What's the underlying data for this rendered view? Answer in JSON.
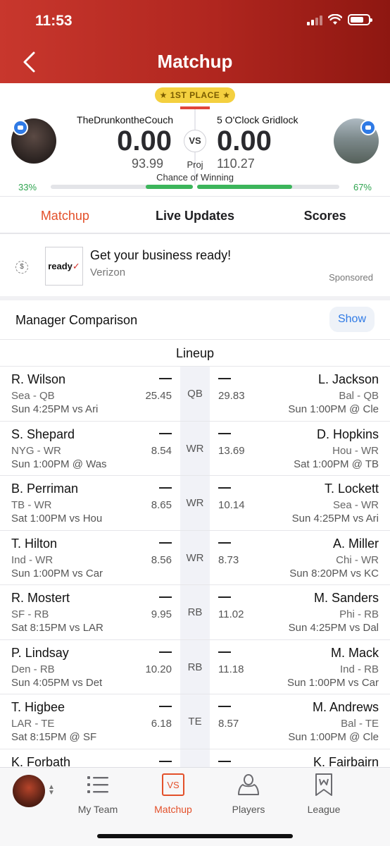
{
  "status_bar": {
    "time": "11:53"
  },
  "header": {
    "title": "Matchup"
  },
  "scoreboard": {
    "badge": "★ 1ST PLACE ★",
    "vs": "VS",
    "proj_label": "Proj",
    "chance_label": "Chance of Winning",
    "left": {
      "team": "TheDrunkontheCouch",
      "score": "0.00",
      "proj": "93.99",
      "pct": "33%",
      "win_fraction": 0.33
    },
    "right": {
      "team": "5 O'Clock Gridlock",
      "score": "0.00",
      "proj": "110.27",
      "pct": "67%",
      "win_fraction": 0.67
    }
  },
  "tabs": [
    {
      "label": "Matchup"
    },
    {
      "label": "Live Updates"
    },
    {
      "label": "Scores"
    }
  ],
  "ad": {
    "logo_text": "ready",
    "logo_mark": "✓",
    "title": "Get your business ready!",
    "advertiser": "Verizon",
    "sponsored": "Sponsored"
  },
  "manager": {
    "title": "Manager Comparison",
    "show_label": "Show"
  },
  "lineup": {
    "title": "Lineup",
    "rows": [
      {
        "pos": "QB",
        "left": {
          "name": "R. Wilson",
          "team": "Sea - QB",
          "game": "Sun 4:25PM vs Ari",
          "score": "—",
          "proj": "25.45"
        },
        "right": {
          "name": "L. Jackson",
          "team": "Bal - QB",
          "game": "Sun 1:00PM @ Cle",
          "score": "—",
          "proj": "29.83"
        }
      },
      {
        "pos": "WR",
        "left": {
          "name": "S. Shepard",
          "team": "NYG - WR",
          "game": "Sun 1:00PM @ Was",
          "score": "—",
          "proj": "8.54"
        },
        "right": {
          "name": "D. Hopkins",
          "team": "Hou - WR",
          "game": "Sat 1:00PM @ TB",
          "score": "—",
          "proj": "13.69"
        }
      },
      {
        "pos": "WR",
        "left": {
          "name": "B. Perriman",
          "team": "TB - WR",
          "game": "Sat 1:00PM vs Hou",
          "score": "—",
          "proj": "8.65"
        },
        "right": {
          "name": "T. Lockett",
          "team": "Sea - WR",
          "game": "Sun 4:25PM vs Ari",
          "score": "—",
          "proj": "10.14"
        }
      },
      {
        "pos": "WR",
        "left": {
          "name": "T. Hilton",
          "team": "Ind - WR",
          "game": "Sun 1:00PM vs Car",
          "score": "—",
          "proj": "8.56"
        },
        "right": {
          "name": "A. Miller",
          "team": "Chi - WR",
          "game": "Sun 8:20PM vs KC",
          "score": "—",
          "proj": "8.73"
        }
      },
      {
        "pos": "RB",
        "left": {
          "name": "R. Mostert",
          "team": "SF - RB",
          "game": "Sat 8:15PM vs LAR",
          "score": "—",
          "proj": "9.95"
        },
        "right": {
          "name": "M. Sanders",
          "team": "Phi - RB",
          "game": "Sun 4:25PM vs Dal",
          "score": "—",
          "proj": "11.02"
        }
      },
      {
        "pos": "RB",
        "left": {
          "name": "P. Lindsay",
          "team": "Den - RB",
          "game": "Sun 4:05PM vs Det",
          "score": "—",
          "proj": "10.20"
        },
        "right": {
          "name": "M. Mack",
          "team": "Ind - RB",
          "game": "Sun 1:00PM vs Car",
          "score": "—",
          "proj": "11.18"
        }
      },
      {
        "pos": "TE",
        "left": {
          "name": "T. Higbee",
          "team": "LAR - TE",
          "game": "Sat 8:15PM @ SF",
          "score": "—",
          "proj": "6.18"
        },
        "right": {
          "name": "M. Andrews",
          "team": "Bal - TE",
          "game": "Sun 1:00PM @ Cle",
          "score": "—",
          "proj": "8.57"
        }
      },
      {
        "pos": "",
        "left": {
          "name": "K. Forbath",
          "team": "",
          "game": "",
          "score": "—",
          "proj": ""
        },
        "right": {
          "name": "K. Fairbairn",
          "team": "",
          "game": "",
          "score": "—",
          "proj": ""
        }
      }
    ]
  },
  "bottom_nav": [
    {
      "label": "My Team",
      "icon": "list-icon"
    },
    {
      "label": "Matchup",
      "icon": "vs-icon",
      "icon_text": "VS"
    },
    {
      "label": "Players",
      "icon": "person-icon"
    },
    {
      "label": "League",
      "icon": "shield-icon"
    }
  ],
  "colors": {
    "header_red": "#b0261f",
    "accent_orange": "#e3502a",
    "win_green": "#3cb55b",
    "badge_gold": "#f4d03f",
    "link_blue": "#2f7ae5"
  }
}
